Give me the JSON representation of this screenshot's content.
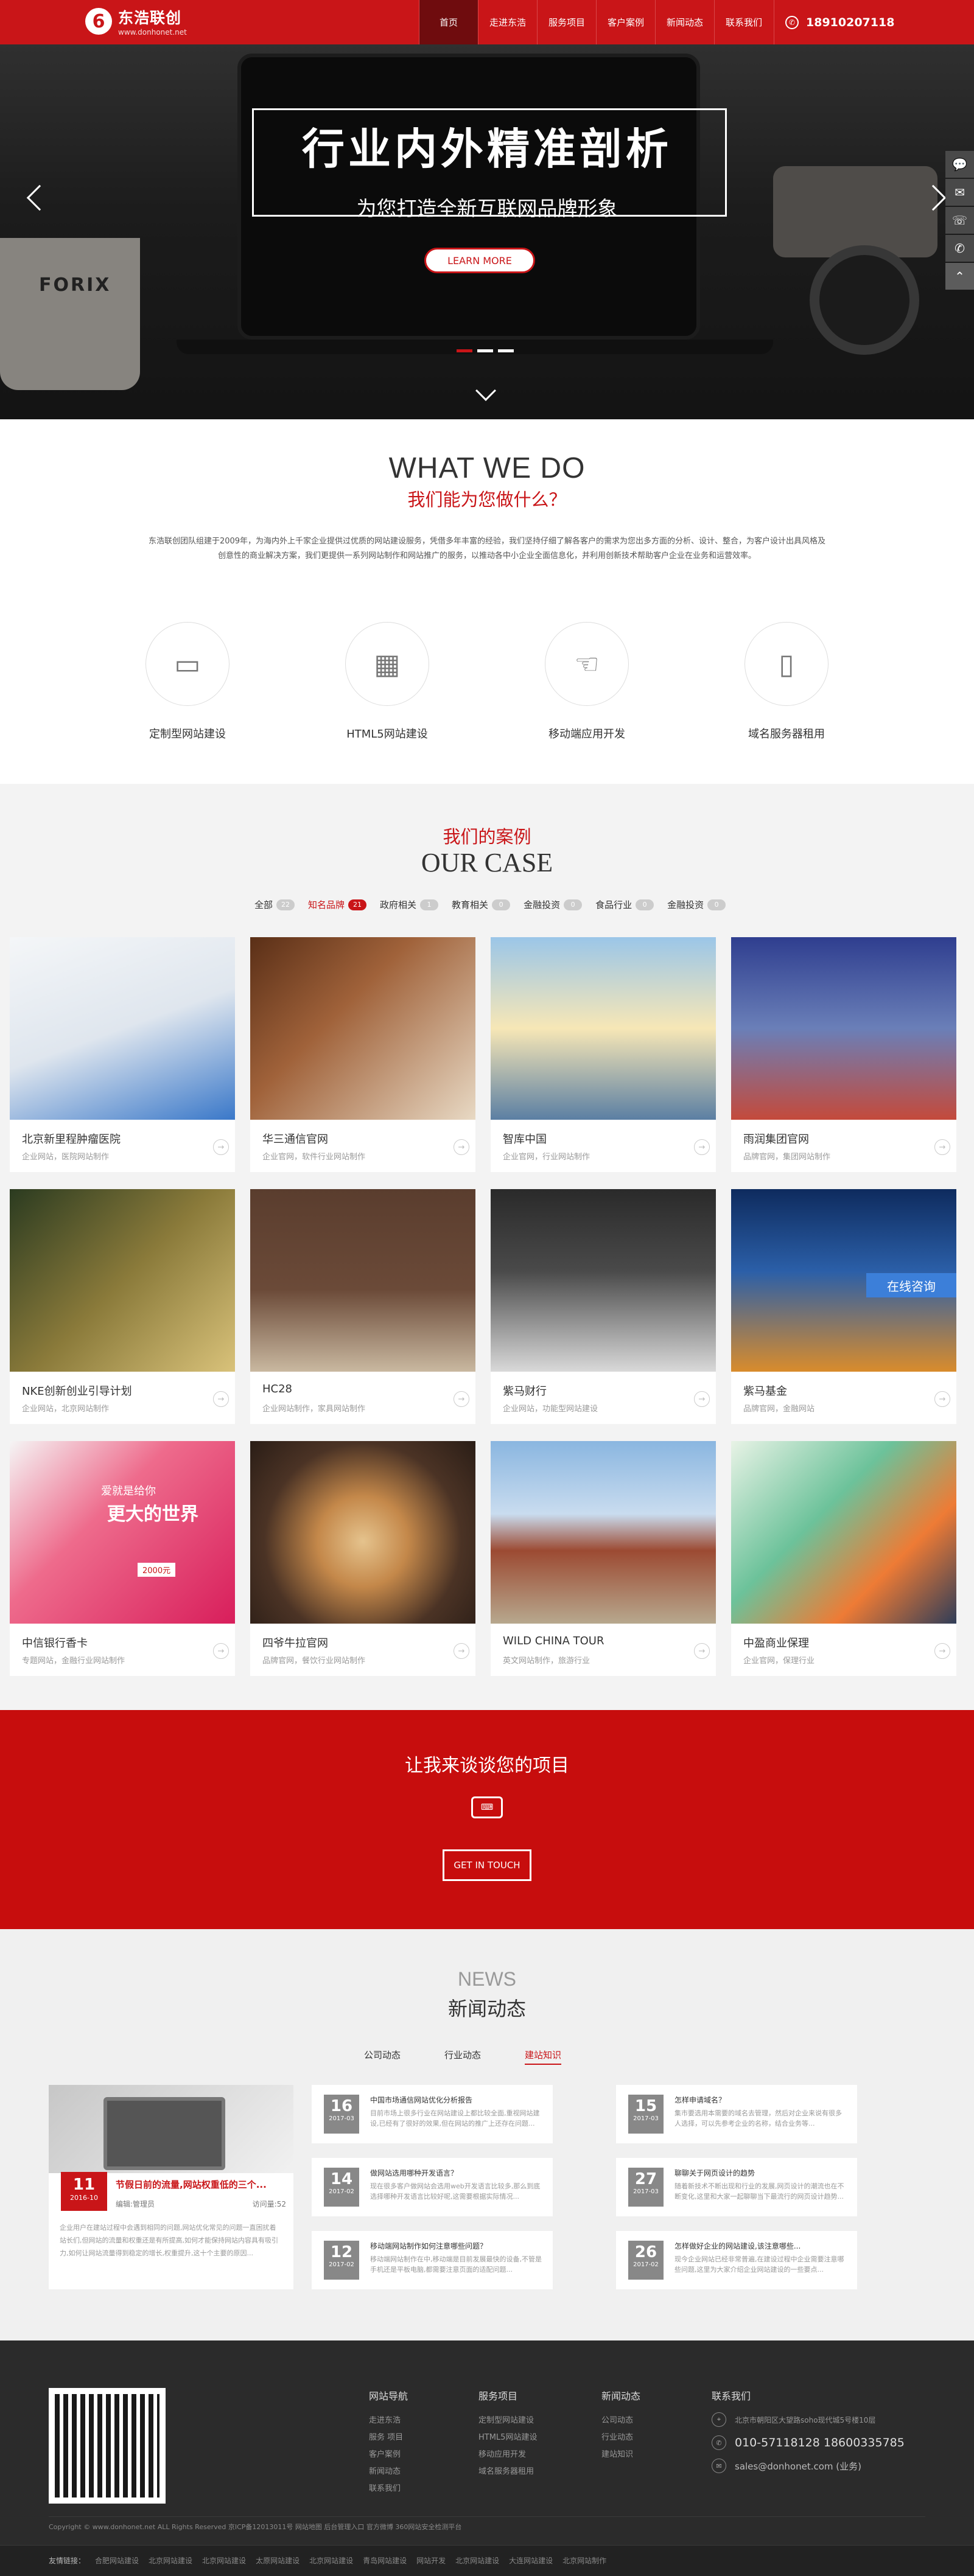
{
  "header": {
    "logo_cn": "东浩联创",
    "logo_en": "www.donhonet.net",
    "nav": [
      "首页",
      "走进东浩",
      "服务项目",
      "客户案例",
      "新闻动态",
      "联系我们"
    ],
    "phone": "18910207118"
  },
  "hero": {
    "title": "行业内外精准剖析",
    "subtitle": "为您打造全新互联网品牌形象",
    "button": "LEARN MORE",
    "mug_text": "FORIX"
  },
  "side_float": [
    "💬",
    "✉",
    "☏",
    "✆",
    "⌃"
  ],
  "what_we_do": {
    "title_en": "WHAT WE DO",
    "title_cn": "我们能为您做什么？",
    "desc": "东浩联创团队组建于2009年，为海内外上千家企业提供过优质的网站建设服务，凭借多年丰富的经验，我们坚持仔细了解各客户的需求为您出多方面的分析、设计、整合，为客户设计出具风格及创意性的商业解决方案，我们更提供一系列网站制作和网站推广的服务，以推动各中小企业全面信息化，并利用创新技术帮助客户企业在业务和运营效率。",
    "services": [
      {
        "label": "定制型网站建设",
        "icon": "desktop-icon"
      },
      {
        "label": "HTML5网站建设",
        "icon": "grid-icon"
      },
      {
        "label": "移动端应用开发",
        "icon": "hand-phone-icon"
      },
      {
        "label": "域名服务器租用",
        "icon": "ruler-icon"
      }
    ]
  },
  "case": {
    "title_cn": "我们的案例",
    "title_en": "OUR CASE",
    "tabs": [
      {
        "label": "全部",
        "count": "22"
      },
      {
        "label": "知名品牌",
        "count": "21"
      },
      {
        "label": "政府相关",
        "count": "1"
      },
      {
        "label": "教育相关",
        "count": "0"
      },
      {
        "label": "金融投资",
        "count": "0"
      },
      {
        "label": "食品行业",
        "count": "0"
      },
      {
        "label": "金融投资",
        "count": "0"
      }
    ],
    "items": [
      {
        "title": "北京新里程肿瘤医院",
        "sub": "企业网站，医院网站制作"
      },
      {
        "title": "华三通信官网",
        "sub": "企业官网，软件行业网站制作"
      },
      {
        "title": "智库中国",
        "sub": "企业官网，行业网站制作"
      },
      {
        "title": "雨润集团官网",
        "sub": "品牌官网，集团网站制作"
      },
      {
        "title": "NKE创新创业引导计划",
        "sub": "企业网站，北京网站制作"
      },
      {
        "title": "HC28",
        "sub": "企业网站制作，家具网站制作"
      },
      {
        "title": "紫马财行",
        "sub": "企业网站，功能型网站建设"
      },
      {
        "title": "紫马基金",
        "sub": "品牌官网，金融网站"
      },
      {
        "title": "中信银行香卡",
        "sub": "专题网站，金融行业网站制作"
      },
      {
        "title": "四爷牛拉官网",
        "sub": "品牌官网，餐饮行业网站制作"
      },
      {
        "title": "WILD CHINA TOUR",
        "sub": "英文网站制作，旅游行业"
      },
      {
        "title": "中盈商业保理",
        "sub": "企业官网，保理行业"
      }
    ],
    "badge": "在线咨询",
    "promo_big": "更大的世界",
    "promo_small": "爱就是给你",
    "promo_amount": "2000元"
  },
  "cta": {
    "title": "让我来谈谈您的项目",
    "button": "GET IN TOUCH"
  },
  "news": {
    "title_en": "NEWS",
    "title_cn": "新闻动态",
    "tabs": [
      "公司动态",
      "行业动态",
      "建站知识"
    ],
    "featured": {
      "day": "11",
      "month": "2016-10",
      "title": "节假日前的流量,网站权重低的三个...",
      "author": "编辑:管理员",
      "views": "访问量:52",
      "desc": "企业用户在建站过程中会遇到相同的问题,网站优化常见的问题一直困扰着站长们,但网站的流量和权重还是有所提高,如何才能保持网站内容具有吸引力,如何让网站流量得到稳定的增长,权重提升,这十个主要的原因..."
    },
    "items": [
      {
        "day": "16",
        "month": "2017-03",
        "title": "中国市场通信网站优化分析报告",
        "desc": "目前市场上很多行业在网站建设上都比较全面,重视网站建设,已经有了很好的效果,但在网站的推广上还存在问题..."
      },
      {
        "day": "15",
        "month": "2017-03",
        "title": "怎样申请域名？",
        "desc": "集市要选用本需要的域名去管理，然后对企业来说有很多人选择，可以先参考企业的名称，结合业务等..."
      },
      {
        "day": "14",
        "month": "2017-02",
        "title": "做网站选用哪种开发语言？",
        "desc": "现在很多客户做网站会选用web开发语言比较多,那么到底选择哪种开发语言比较好呢,这需要根据实际情况..."
      },
      {
        "day": "27",
        "month": "2017-03",
        "title": "聊聊关于网页设计的趋势",
        "desc": "随着新技术不断出现和行业的发展,网页设计的潮流也在不断变化,这里和大家一起聊聊当下最流行的网页设计趋势..."
      },
      {
        "day": "12",
        "month": "2017-02",
        "title": "移动端网站制作如何注意哪些问题？",
        "desc": "移动端网站制作在中,移动端是目前发展最快的设备,不管是手机还是平板电脑,都需要注意页面的适配问题..."
      },
      {
        "day": "26",
        "month": "2017-02",
        "title": "怎样做好企业的网站建设,该注意哪些...",
        "desc": "现今企业网站已经非常普遍,在建设过程中企业需要注意哪些问题,这里为大家介绍企业网站建设的一些要点..."
      }
    ]
  },
  "footer": {
    "cols": [
      {
        "head": "网站导航",
        "links": [
          "走进东浩",
          "服务 项目",
          "客户案例",
          "新闻动态",
          "联系我们"
        ]
      },
      {
        "head": "服务项目",
        "links": [
          "定制型网站建设",
          "HTML5网站建设",
          "移动应用开发",
          "域名服务器租用"
        ]
      },
      {
        "head": "新闻动态",
        "links": [
          "公司动态",
          "行业动态",
          "建站知识"
        ]
      }
    ],
    "contact_head": "联系我们",
    "address": "北京市朝阳区大望路soho现代城5号楼10层",
    "phones": "010-57118128 18600335785",
    "email": "sales@donhonet.com (业务)",
    "copyright": "Copyright © www.donhonet.net ALL Rights Reserved 京ICP备12013011号  网站地图  后台管理入口  官方微博 360网站安全检测平台",
    "links_label": "友情链接：",
    "links": [
      "合肥网站建设",
      "北京网站建设",
      "北京网站建设",
      "太原网站建设",
      "北京网站建设",
      "青岛网站建设",
      "网站开发",
      "北京网站建设",
      "大连网站建设",
      "北京网站制作"
    ]
  }
}
